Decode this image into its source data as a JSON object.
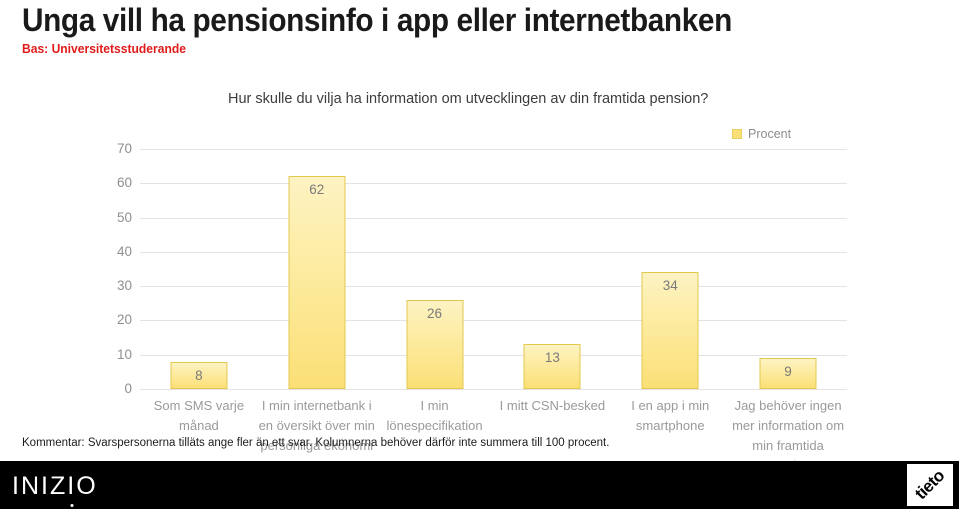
{
  "header": {
    "title": "Unga vill ha pensionsinfo i app eller internetbanken",
    "subtitle": "Bas: Universitetsstuderande",
    "subtitle_color": "#e01b1b"
  },
  "chart_data": {
    "type": "bar",
    "title": "Hur skulle du vilja ha information om utvecklingen av din framtida pension?",
    "categories": [
      "Som SMS varje månad",
      "I min internetbank i en översikt över min personliga ekonomi",
      "I min lönespecifikation",
      "I mitt CSN-besked",
      "I en app i min smartphone",
      "Jag behöver ingen mer information om min framtida pension"
    ],
    "values": [
      8,
      62,
      26,
      13,
      34,
      9
    ],
    "series": [
      {
        "name": "Procent",
        "values": [
          8,
          62,
          26,
          13,
          34,
          9
        ]
      }
    ],
    "legend": [
      "Procent"
    ],
    "legend_position": "top-right",
    "xlabel": "",
    "ylabel": "",
    "ylim": [
      0,
      70
    ],
    "yticks": [
      70,
      60,
      50,
      40,
      30,
      20,
      10,
      0
    ],
    "grid": true,
    "bar_color": "#fbdf76",
    "bar_border_color": "#e3c84f"
  },
  "footnote": "Kommentar: Svarspersonerna tilläts ange fler än ett svar. Kolumnerna behöver därför inte summera till 100 procent.",
  "branding": {
    "primary_logo": "INIZIO",
    "secondary_logo": "tieto"
  }
}
